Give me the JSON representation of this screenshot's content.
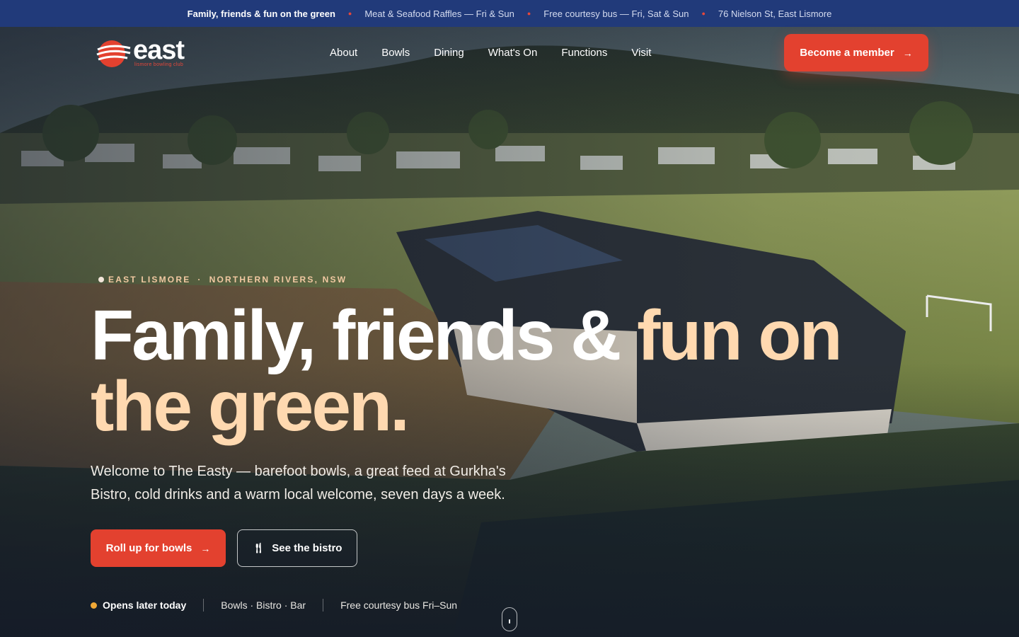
{
  "topbar": {
    "items": [
      "Family, friends & fun on the green",
      "Meat & Seafood Raffles — Fri & Sun",
      "Free courtesy bus — Fri, Sat & Sun",
      "76 Nielson St, East Lismore"
    ]
  },
  "brand": {
    "wordmark": "east",
    "tagline": "lismore bowling club"
  },
  "nav": {
    "items": [
      "About",
      "Bowls",
      "Dining",
      "What's On",
      "Functions",
      "Visit"
    ],
    "cta": "Become a member"
  },
  "hero": {
    "eyebrow": {
      "location": "EAST LISMORE",
      "region": "NORTHERN RIVERS, NSW"
    },
    "headline_white": "Family, friends & ",
    "headline_accent_1": "fun on",
    "headline_accent_2": "the green.",
    "lede": "Welcome to The Easty — barefoot bowls, a great feed at Gurkha's Bistro, cold drinks and a warm local welcome, seven days a week.",
    "primary_button": "Roll up for bowls",
    "secondary_button": "See the bistro",
    "status": {
      "open": "Opens later today",
      "offerings": "Bowls · Bistro · Bar",
      "bus": "Free courtesy bus Fri–Sun"
    }
  },
  "colors": {
    "topbar": "#213a7a",
    "accent_red": "#e3412f",
    "headline_accent": "#ffd9b0",
    "status_dot": "#f0a836"
  },
  "icons": {
    "arrow": "arrow-right-icon",
    "fork": "cutlery-icon",
    "scroll": "scroll-mouse-icon"
  }
}
